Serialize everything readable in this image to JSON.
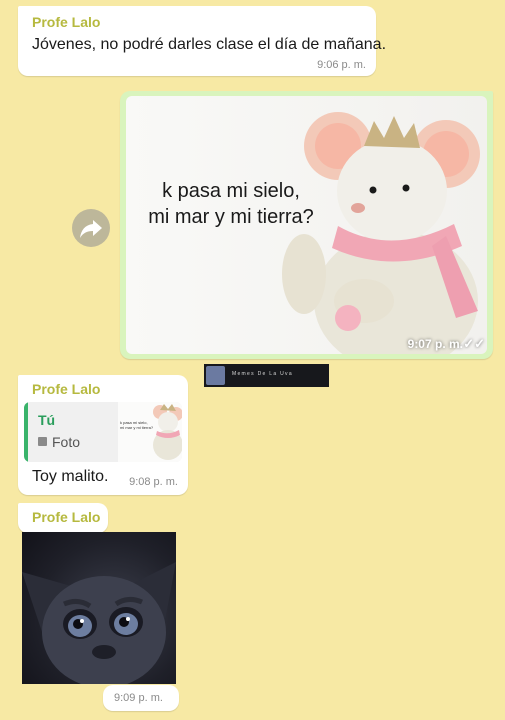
{
  "messages": {
    "m1": {
      "sender": "Profe Lalo",
      "text": "Jóvenes, no podré darles clase el día de mañana.",
      "time": "9:06 p. m."
    },
    "m2": {
      "image_text_line1": "k pasa mi sielo,",
      "image_text_line2": "mi mar y mi tierra?",
      "time": "9:07 p. m.",
      "ticks": "✓✓"
    },
    "watermark": {
      "text": "Memes De La Uva"
    },
    "m3": {
      "sender": "Profe Lalo",
      "quote_author": "Tú",
      "quote_type": "Foto",
      "quote_thumb_line1": "k pasa mi sielo,",
      "quote_thumb_line2": "mi mar y mi tierra?",
      "text": "Toy malito.",
      "time": "9:08 p. m."
    },
    "m4": {
      "sender": "Profe Lalo",
      "time": "9:09 p. m."
    }
  },
  "icons": {
    "forward": "forward-arrow-icon",
    "photo": "photo-icon",
    "read_receipt": "double-check-icon"
  },
  "colors": {
    "background": "#f7e9a4",
    "sender": "#b6b93f",
    "sent_bubble": "#d9f4bd",
    "quote_bar": "#39b36a"
  }
}
